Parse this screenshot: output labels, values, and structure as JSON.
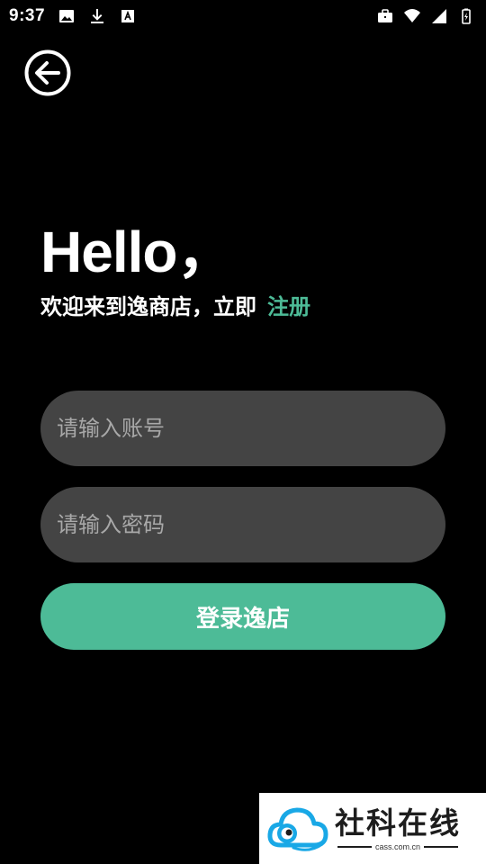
{
  "status_bar": {
    "time": "9:37",
    "left_icons": [
      "image-icon",
      "download-icon",
      "font-icon"
    ],
    "right_icons": [
      "briefcase-icon",
      "wifi-icon",
      "signal-icon",
      "battery-icon"
    ]
  },
  "header": {
    "back_icon": "arrow-left-circle-icon"
  },
  "greeting": {
    "title": "Hello，",
    "subtitle": "欢迎来到逸商店，立即",
    "register_link": "注册"
  },
  "form": {
    "account_placeholder": "请输入账号",
    "account_value": "",
    "password_placeholder": "请输入密码",
    "password_value": "",
    "login_label": "登录逸店"
  },
  "watermark": {
    "title": "社科在线",
    "subtitle": "cass.com.cn"
  },
  "colors": {
    "background": "#000000",
    "accent": "#4dbb97",
    "field_bg": "#444444",
    "placeholder": "#a8a8a8"
  }
}
